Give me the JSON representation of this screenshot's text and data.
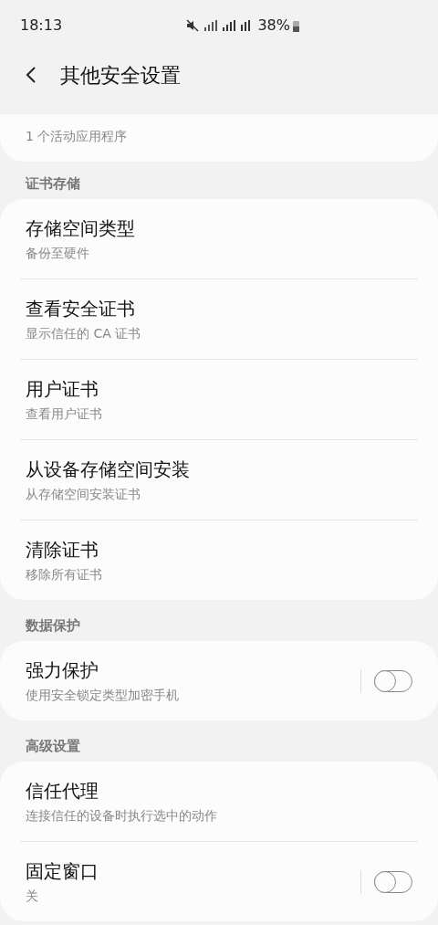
{
  "status_bar": {
    "time": "18:13",
    "battery": "38%"
  },
  "header": {
    "title": "其他安全设置"
  },
  "top_card": {
    "subtitle": "1 个活动应用程序"
  },
  "sections": [
    {
      "title": "证书存储",
      "items": [
        {
          "kind": "text",
          "title": "存储空间类型",
          "subtitle": "备份至硬件"
        },
        {
          "kind": "text",
          "title": "查看安全证书",
          "subtitle": "显示信任的 CA 证书"
        },
        {
          "kind": "text",
          "title": "用户证书",
          "subtitle": "查看用户证书"
        },
        {
          "kind": "text",
          "title": "从设备存储空间安装",
          "subtitle": "从存储空间安装证书"
        },
        {
          "kind": "text",
          "title": "清除证书",
          "subtitle": "移除所有证书"
        }
      ]
    },
    {
      "title": "数据保护",
      "items": [
        {
          "kind": "switch",
          "title": "强力保护",
          "subtitle": "使用安全锁定类型加密手机",
          "on": false
        }
      ]
    },
    {
      "title": "高级设置",
      "items": [
        {
          "kind": "text",
          "title": "信任代理",
          "subtitle": "连接信任的设备时执行选中的动作"
        },
        {
          "kind": "switch",
          "title": "固定窗口",
          "subtitle": "关",
          "on": false
        }
      ]
    }
  ]
}
